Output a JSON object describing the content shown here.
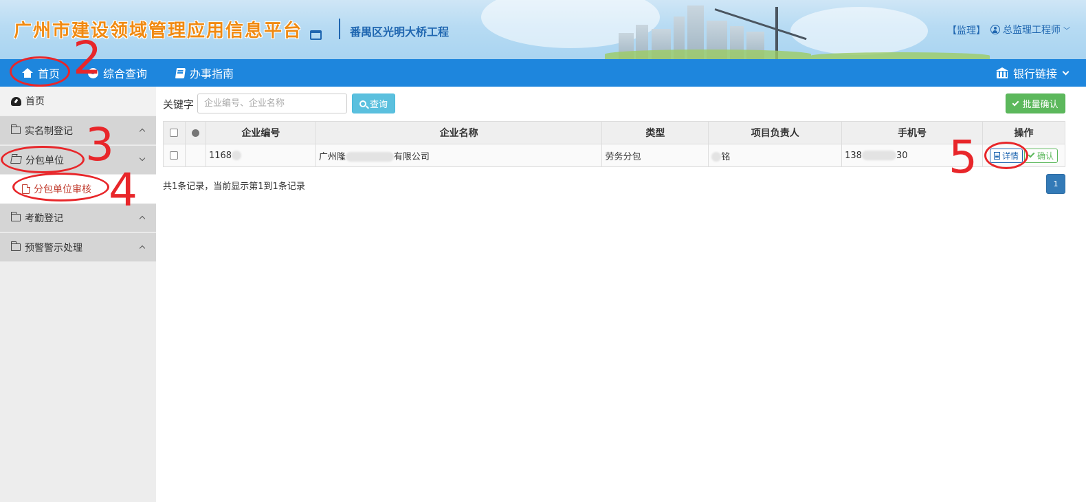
{
  "header": {
    "site_title": "广州市建设领域管理应用信息平台",
    "project_name": "番禺区光明大桥工程",
    "role": "【监理】",
    "user_name": "总监理工程师"
  },
  "nav": {
    "items": [
      {
        "label": "首页",
        "icon": "home-icon"
      },
      {
        "label": "综合查询",
        "icon": "globe-icon"
      },
      {
        "label": "办事指南",
        "icon": "book-icon"
      }
    ],
    "bank": {
      "label": "银行链接",
      "icon": "bank-icon"
    }
  },
  "sidebar": {
    "home": "首页",
    "groups": [
      {
        "label": "实名制登记",
        "expanded": false
      },
      {
        "label": "分包单位",
        "expanded": true,
        "children": [
          {
            "label": "分包单位审核"
          }
        ]
      },
      {
        "label": "考勤登记",
        "expanded": false
      },
      {
        "label": "预警警示处理",
        "expanded": false
      }
    ]
  },
  "search": {
    "label": "关键字",
    "placeholder": "企业编号、企业名称",
    "button": "查询"
  },
  "toolbar": {
    "batch_confirm": "批量确认"
  },
  "table": {
    "headers": [
      "企业编号",
      "企业名称",
      "类型",
      "项目负责人",
      "手机号",
      "操作"
    ],
    "rows": [
      {
        "code": "1168",
        "name_prefix": "广州隆",
        "name_suffix": "有限公司",
        "type": "劳务分包",
        "manager": "铭",
        "phone_prefix": "138",
        "phone_suffix": "30",
        "detail_label": "详情",
        "confirm_label": "确认"
      }
    ]
  },
  "pagination": {
    "summary": "共1条记录，当前显示第1到1条记录",
    "current_page": "1"
  },
  "annotations": [
    "2",
    "3",
    "4",
    "5"
  ],
  "colors": {
    "nav_bg": "#1e86dd",
    "title_orange": "#f08a12",
    "link_blue": "#1f66b0",
    "annotation_red": "#e8262a",
    "success_green": "#5cb85c",
    "info_cyan": "#5bc0de"
  }
}
